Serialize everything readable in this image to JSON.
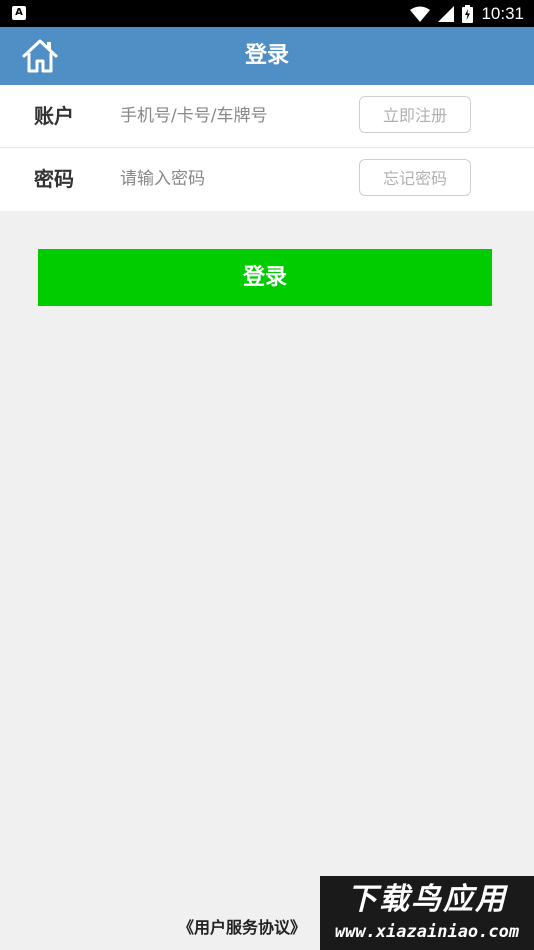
{
  "status_bar": {
    "time": "10:31",
    "app_icon_letter": "A",
    "icons": [
      "wifi-icon",
      "cell-signal-icon",
      "battery-icon"
    ]
  },
  "app_bar": {
    "title": "登录",
    "home_icon": "home-icon",
    "background": "#4f8fc6"
  },
  "form": {
    "account": {
      "label": "账户",
      "placeholder": "手机号/卡号/车牌号",
      "value": "",
      "action": "立即注册"
    },
    "password": {
      "label": "密码",
      "placeholder": "请输入密码",
      "value": "",
      "action": "忘记密码"
    }
  },
  "login_button": {
    "label": "登录",
    "color": "#00cc00"
  },
  "footer": {
    "agreement": "《用户服务协议》"
  },
  "watermark": {
    "title": "下载鸟应用",
    "url": "www.xiazainiao.com"
  }
}
